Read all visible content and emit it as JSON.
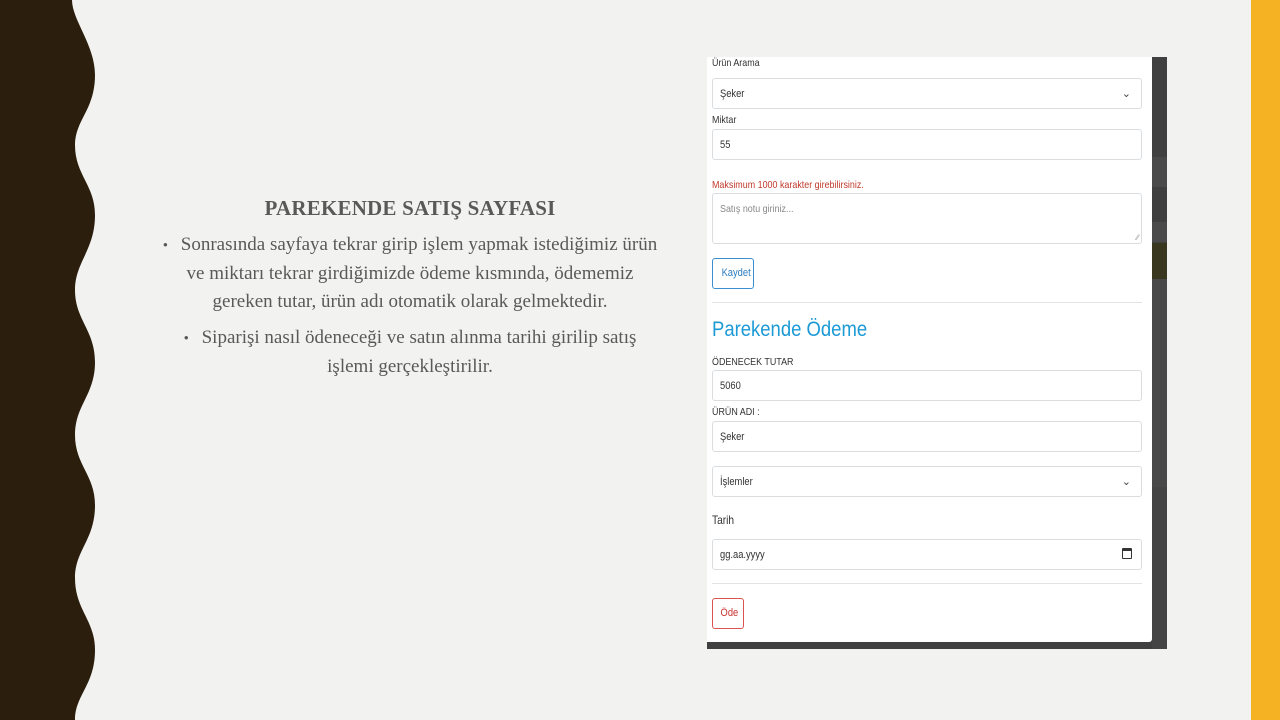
{
  "slide": {
    "title": "PAREKENDE SATIŞ SAYFASI",
    "bullets": [
      "Sonrasında sayfaya tekrar girip işlem yapmak istediğimiz ürün ve miktarı tekrar girdiğimizde ödeme kısmında, ödememiz gereken tutar, ürün adı otomatik olarak gelmektedir.",
      "Siparişi nasıl ödeneceği ve satın alınma tarihi girilip satış işlemi gerçekleştirilir."
    ]
  },
  "form": {
    "search_label": "Ürün Arama",
    "search_value": "Şeker",
    "qty_label": "Miktar",
    "qty_value": "55",
    "note_error": "Maksimum 1000 karakter girebilirsiniz.",
    "note_placeholder": "Satış notu giriniz...",
    "save_label": "Kaydet",
    "payment_title": "Parekende Ödeme",
    "amount_label": "ÖDENECEK TUTAR",
    "amount_value": "5060",
    "product_label": "ÜRÜN ADI :",
    "product_value": "Şeker",
    "operations_value": "İşlemler",
    "date_label": "Tarih",
    "date_placeholder": "gg.aa.yyyy",
    "pay_label": "Öde"
  },
  "colors": {
    "left_band": "#2b1e0c",
    "right_bar": "#f5b324",
    "accent_blue": "#1c9ad6",
    "error_red": "#c0392b"
  }
}
